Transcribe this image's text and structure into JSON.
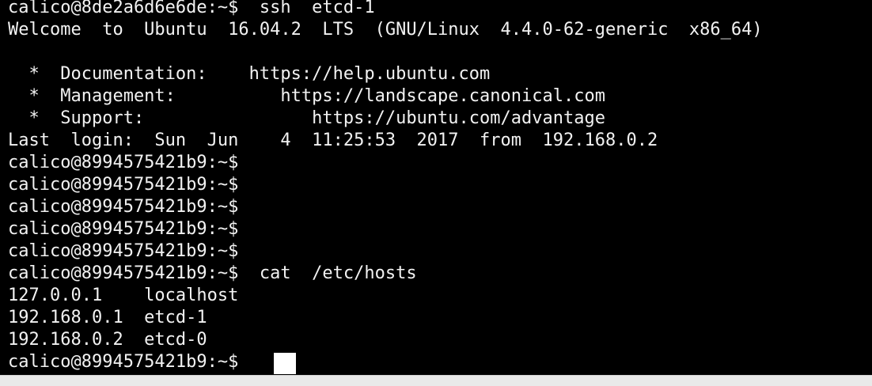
{
  "terminal": {
    "lines": [
      "calico@8de2a6d6e6de:~$  ssh  etcd-1",
      "Welcome  to  Ubuntu  16.04.2  LTS  (GNU/Linux  4.4.0-62-generic  x86_64)",
      "",
      "  *  Documentation:    https://help.ubuntu.com",
      "  *  Management:          https://landscape.canonical.com",
      "  *  Support:                https://ubuntu.com/advantage",
      "Last  login:  Sun  Jun    4  11:25:53  2017  from  192.168.0.2",
      "calico@8994575421b9:~$",
      "calico@8994575421b9:~$",
      "calico@8994575421b9:~$",
      "calico@8994575421b9:~$",
      "calico@8994575421b9:~$",
      "calico@8994575421b9:~$  cat  /etc/hosts",
      "127.0.0.1    localhost",
      "192.168.0.1  etcd-1",
      "192.168.0.2  etcd-0",
      "calico@8994575421b9:~$"
    ]
  },
  "colors": {
    "background": "#000000",
    "foreground": "#f2f2f2",
    "cursor": "#ffffff"
  }
}
